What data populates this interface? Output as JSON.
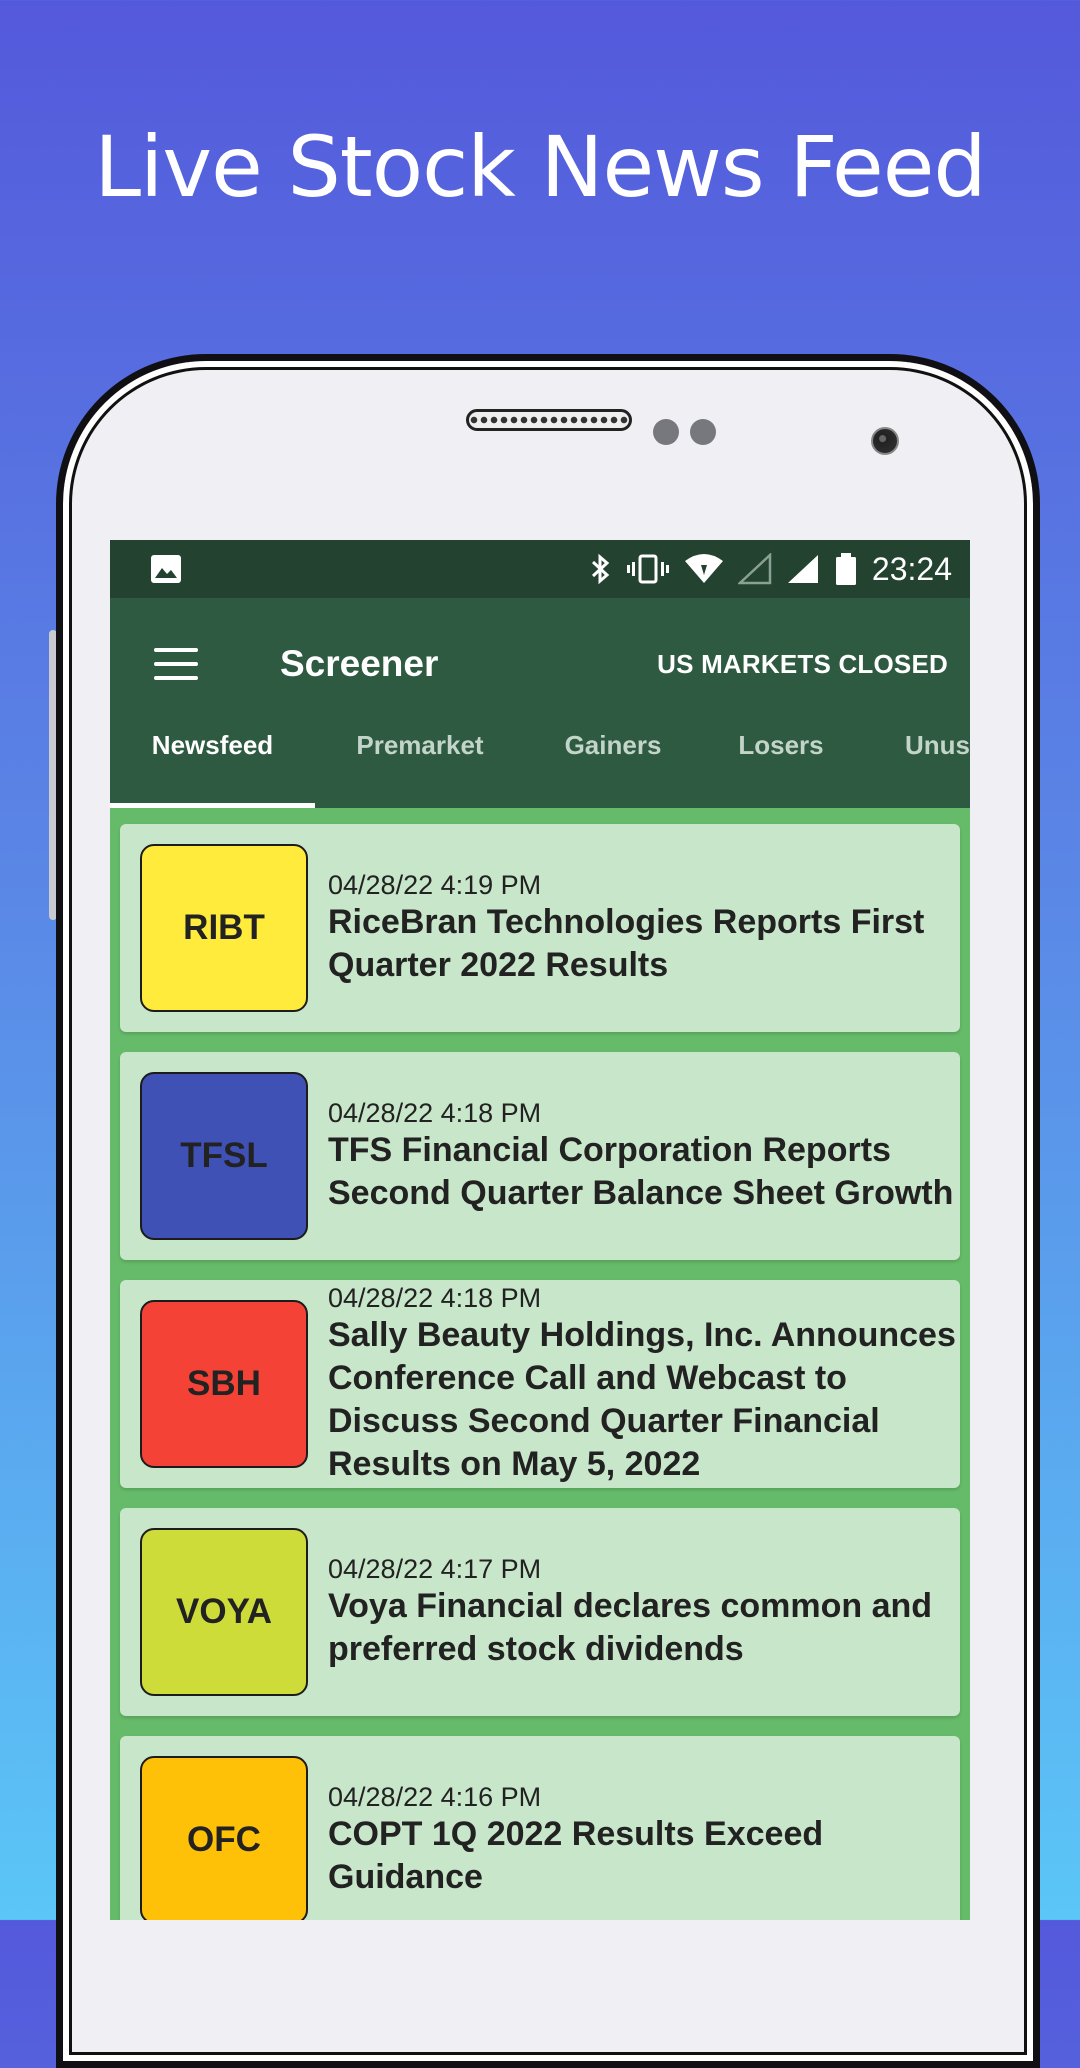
{
  "headline": "Live Stock News Feed",
  "status_bar": {
    "time": "23:24",
    "icons": [
      "image-icon",
      "bluetooth-icon",
      "vibrate-icon",
      "wifi-icon",
      "signal-empty-icon",
      "signal-icon",
      "battery-icon"
    ]
  },
  "app_bar": {
    "title": "Screener",
    "market_status": "US MARKETS CLOSED"
  },
  "tabs": [
    {
      "label": "Newsfeed",
      "active": true
    },
    {
      "label": "Premarket",
      "active": false
    },
    {
      "label": "Gainers",
      "active": false
    },
    {
      "label": "Losers",
      "active": false
    },
    {
      "label": "Unus",
      "active": false
    }
  ],
  "feed": [
    {
      "ticker": "RIBT",
      "color": "#ffeb3b",
      "time": "04/28/22 4:19 PM",
      "headline": "RiceBran Technologies Reports First Quarter 2022 Results"
    },
    {
      "ticker": "TFSL",
      "color": "#3f51b5",
      "time": "04/28/22 4:18 PM",
      "headline": "TFS Financial Corporation Reports Second Quarter Balance Sheet Growth"
    },
    {
      "ticker": "SBH",
      "color": "#f44336",
      "time": "04/28/22 4:18 PM",
      "headline": "Sally Beauty Holdings, Inc. Announces Conference Call and Webcast to Discuss Second Quarter Financial Results on May 5, 2022"
    },
    {
      "ticker": "VOYA",
      "color": "#cddc39",
      "time": "04/28/22 4:17 PM",
      "headline": "Voya Financial declares common and preferred stock dividends"
    },
    {
      "ticker": "OFC",
      "color": "#ffc107",
      "time": "04/28/22 4:16 PM",
      "headline": "COPT 1Q 2022 Results Exceed Guidance"
    }
  ]
}
